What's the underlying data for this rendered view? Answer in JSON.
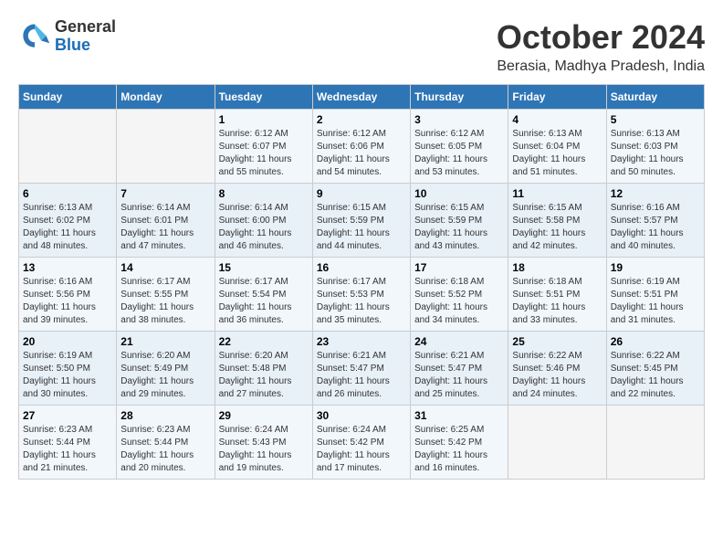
{
  "header": {
    "logo": {
      "line1": "General",
      "line2": "Blue"
    },
    "title": "October 2024",
    "location": "Berasia, Madhya Pradesh, India"
  },
  "days_of_week": [
    "Sunday",
    "Monday",
    "Tuesday",
    "Wednesday",
    "Thursday",
    "Friday",
    "Saturday"
  ],
  "weeks": [
    [
      {
        "day": "",
        "info": ""
      },
      {
        "day": "",
        "info": ""
      },
      {
        "day": "1",
        "info": "Sunrise: 6:12 AM\nSunset: 6:07 PM\nDaylight: 11 hours and 55 minutes."
      },
      {
        "day": "2",
        "info": "Sunrise: 6:12 AM\nSunset: 6:06 PM\nDaylight: 11 hours and 54 minutes."
      },
      {
        "day": "3",
        "info": "Sunrise: 6:12 AM\nSunset: 6:05 PM\nDaylight: 11 hours and 53 minutes."
      },
      {
        "day": "4",
        "info": "Sunrise: 6:13 AM\nSunset: 6:04 PM\nDaylight: 11 hours and 51 minutes."
      },
      {
        "day": "5",
        "info": "Sunrise: 6:13 AM\nSunset: 6:03 PM\nDaylight: 11 hours and 50 minutes."
      }
    ],
    [
      {
        "day": "6",
        "info": "Sunrise: 6:13 AM\nSunset: 6:02 PM\nDaylight: 11 hours and 48 minutes."
      },
      {
        "day": "7",
        "info": "Sunrise: 6:14 AM\nSunset: 6:01 PM\nDaylight: 11 hours and 47 minutes."
      },
      {
        "day": "8",
        "info": "Sunrise: 6:14 AM\nSunset: 6:00 PM\nDaylight: 11 hours and 46 minutes."
      },
      {
        "day": "9",
        "info": "Sunrise: 6:15 AM\nSunset: 5:59 PM\nDaylight: 11 hours and 44 minutes."
      },
      {
        "day": "10",
        "info": "Sunrise: 6:15 AM\nSunset: 5:59 PM\nDaylight: 11 hours and 43 minutes."
      },
      {
        "day": "11",
        "info": "Sunrise: 6:15 AM\nSunset: 5:58 PM\nDaylight: 11 hours and 42 minutes."
      },
      {
        "day": "12",
        "info": "Sunrise: 6:16 AM\nSunset: 5:57 PM\nDaylight: 11 hours and 40 minutes."
      }
    ],
    [
      {
        "day": "13",
        "info": "Sunrise: 6:16 AM\nSunset: 5:56 PM\nDaylight: 11 hours and 39 minutes."
      },
      {
        "day": "14",
        "info": "Sunrise: 6:17 AM\nSunset: 5:55 PM\nDaylight: 11 hours and 38 minutes."
      },
      {
        "day": "15",
        "info": "Sunrise: 6:17 AM\nSunset: 5:54 PM\nDaylight: 11 hours and 36 minutes."
      },
      {
        "day": "16",
        "info": "Sunrise: 6:17 AM\nSunset: 5:53 PM\nDaylight: 11 hours and 35 minutes."
      },
      {
        "day": "17",
        "info": "Sunrise: 6:18 AM\nSunset: 5:52 PM\nDaylight: 11 hours and 34 minutes."
      },
      {
        "day": "18",
        "info": "Sunrise: 6:18 AM\nSunset: 5:51 PM\nDaylight: 11 hours and 33 minutes."
      },
      {
        "day": "19",
        "info": "Sunrise: 6:19 AM\nSunset: 5:51 PM\nDaylight: 11 hours and 31 minutes."
      }
    ],
    [
      {
        "day": "20",
        "info": "Sunrise: 6:19 AM\nSunset: 5:50 PM\nDaylight: 11 hours and 30 minutes."
      },
      {
        "day": "21",
        "info": "Sunrise: 6:20 AM\nSunset: 5:49 PM\nDaylight: 11 hours and 29 minutes."
      },
      {
        "day": "22",
        "info": "Sunrise: 6:20 AM\nSunset: 5:48 PM\nDaylight: 11 hours and 27 minutes."
      },
      {
        "day": "23",
        "info": "Sunrise: 6:21 AM\nSunset: 5:47 PM\nDaylight: 11 hours and 26 minutes."
      },
      {
        "day": "24",
        "info": "Sunrise: 6:21 AM\nSunset: 5:47 PM\nDaylight: 11 hours and 25 minutes."
      },
      {
        "day": "25",
        "info": "Sunrise: 6:22 AM\nSunset: 5:46 PM\nDaylight: 11 hours and 24 minutes."
      },
      {
        "day": "26",
        "info": "Sunrise: 6:22 AM\nSunset: 5:45 PM\nDaylight: 11 hours and 22 minutes."
      }
    ],
    [
      {
        "day": "27",
        "info": "Sunrise: 6:23 AM\nSunset: 5:44 PM\nDaylight: 11 hours and 21 minutes."
      },
      {
        "day": "28",
        "info": "Sunrise: 6:23 AM\nSunset: 5:44 PM\nDaylight: 11 hours and 20 minutes."
      },
      {
        "day": "29",
        "info": "Sunrise: 6:24 AM\nSunset: 5:43 PM\nDaylight: 11 hours and 19 minutes."
      },
      {
        "day": "30",
        "info": "Sunrise: 6:24 AM\nSunset: 5:42 PM\nDaylight: 11 hours and 17 minutes."
      },
      {
        "day": "31",
        "info": "Sunrise: 6:25 AM\nSunset: 5:42 PM\nDaylight: 11 hours and 16 minutes."
      },
      {
        "day": "",
        "info": ""
      },
      {
        "day": "",
        "info": ""
      }
    ]
  ]
}
